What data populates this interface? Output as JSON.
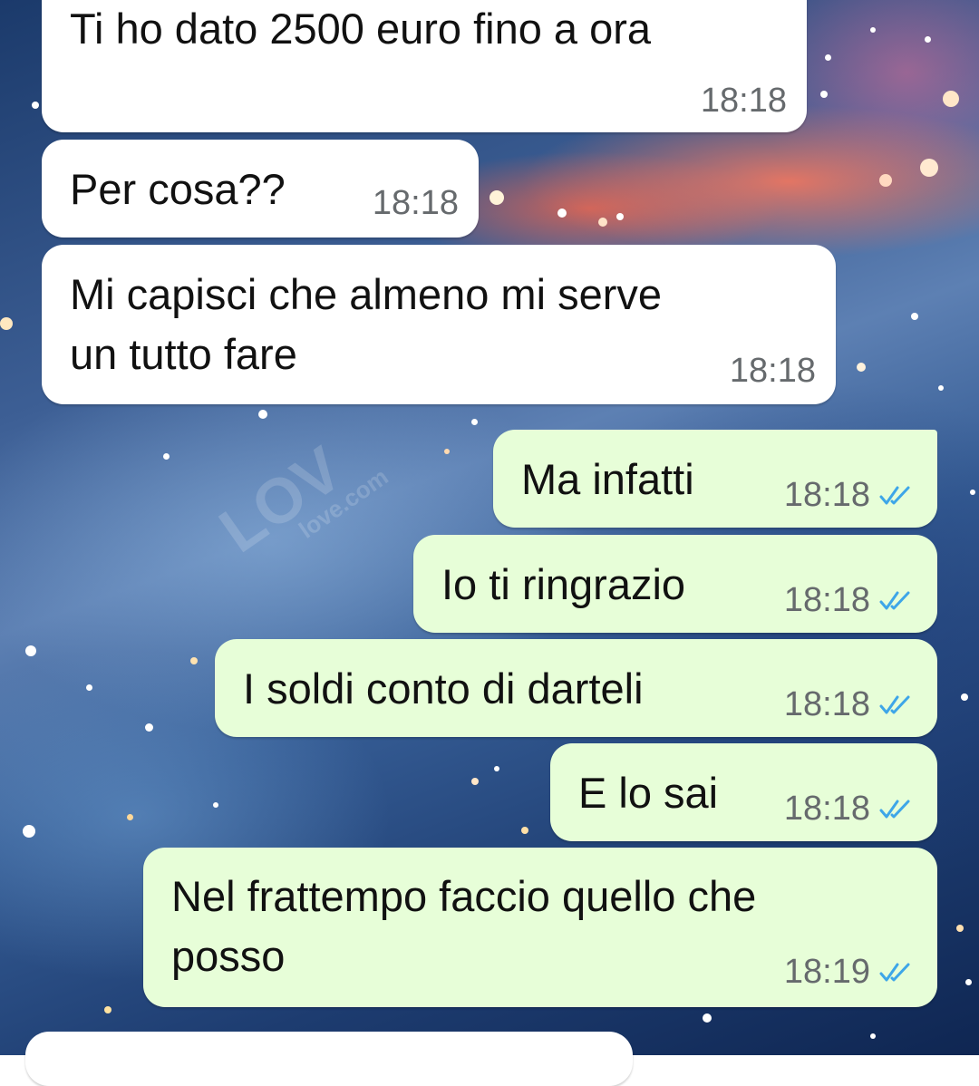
{
  "wallpaper": {
    "description": "space-nebula-wallpaper",
    "accent_colors": [
      "#1b3a6b",
      "#5d80b3",
      "#ff785a"
    ]
  },
  "watermark": {
    "text": "LOV",
    "sub": "love.com"
  },
  "colors": {
    "incoming_bubble": "#ffffff",
    "outgoing_bubble": "#e7fed8",
    "read_ticks": "#3ea6e8",
    "timestamp": "#666a6d"
  },
  "messages": [
    {
      "direction": "in",
      "lines": [
        "Ti ho dato 2500 euro fino a ora"
      ],
      "time": "18:18"
    },
    {
      "direction": "in",
      "lines": [
        "Per cosa??"
      ],
      "time": "18:18"
    },
    {
      "direction": "in",
      "lines": [
        "Mi capisci che almeno mi serve",
        "un tutto fare"
      ],
      "time": "18:18"
    },
    {
      "direction": "out",
      "lines": [
        "Ma infatti"
      ],
      "time": "18:18",
      "status": "double-check-icon"
    },
    {
      "direction": "out",
      "lines": [
        "Io ti ringrazio"
      ],
      "time": "18:18",
      "status": "double-check-icon"
    },
    {
      "direction": "out",
      "lines": [
        "I soldi conto di darteli"
      ],
      "time": "18:18",
      "status": "double-check-icon"
    },
    {
      "direction": "out",
      "lines": [
        "E lo sai"
      ],
      "time": "18:18",
      "status": "double-check-icon"
    },
    {
      "direction": "out",
      "lines": [
        "Nel frattempo faccio quello che",
        "posso"
      ],
      "time": "18:19",
      "status": "double-check-icon"
    }
  ]
}
